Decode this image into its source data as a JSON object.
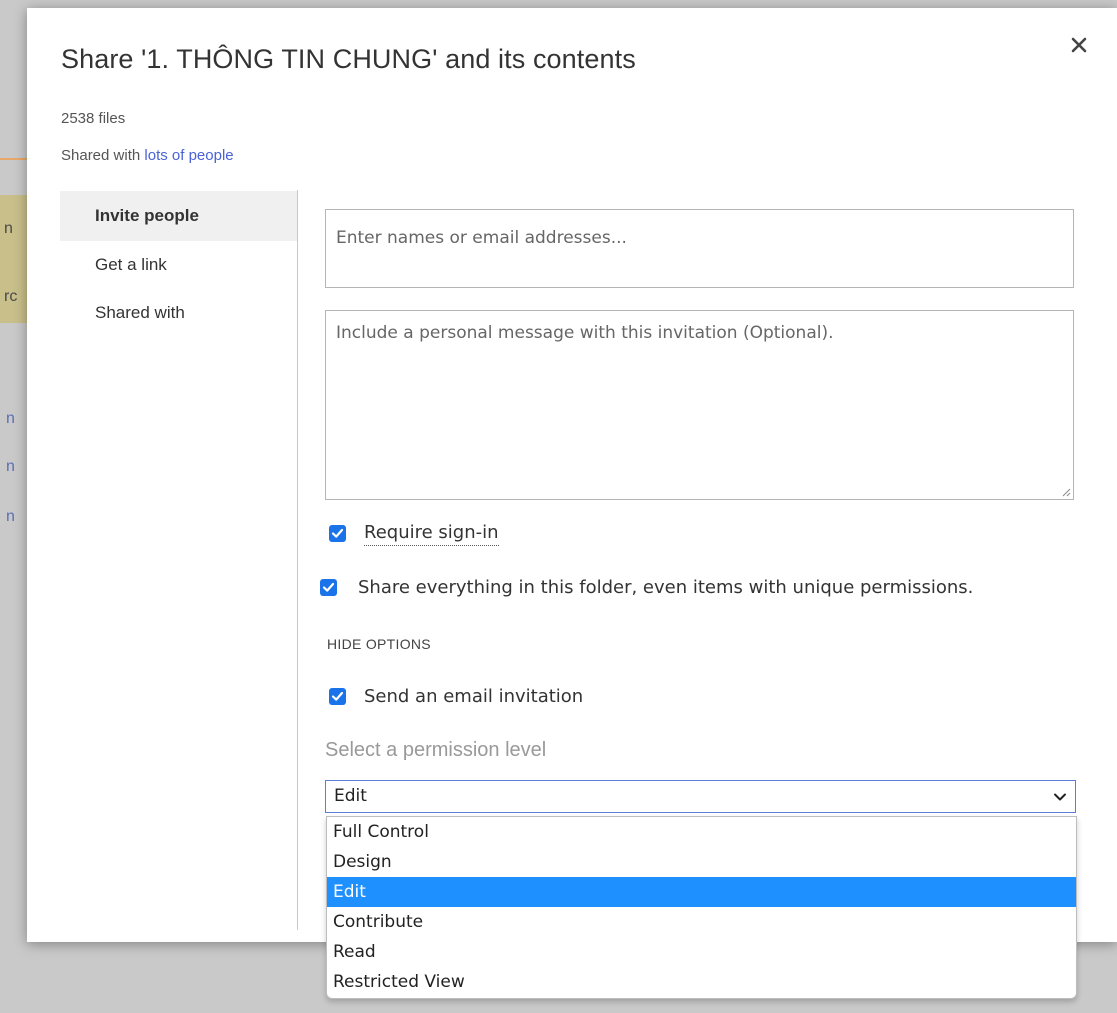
{
  "background": {
    "fragments": [
      "n",
      "rc"
    ],
    "links": [
      "n",
      "n",
      "n"
    ]
  },
  "dialog": {
    "title": "Share '1. THÔNG TIN CHUNG' and its contents",
    "file_count": "2538 files",
    "shared_prefix": "Shared with ",
    "shared_link": "lots of people"
  },
  "nav": {
    "items": [
      {
        "label": "Invite people"
      },
      {
        "label": "Get a link"
      },
      {
        "label": "Shared with"
      }
    ]
  },
  "form": {
    "names_placeholder": "Enter names or email addresses...",
    "message_placeholder": "Include a personal message with this invitation (Optional).",
    "require_signin": {
      "label": "Require sign-in",
      "checked": true
    },
    "share_everything": {
      "label": "Share everything in this folder, even items with unique permissions.",
      "checked": true
    },
    "hide_options": "HIDE OPTIONS",
    "send_email": {
      "label": "Send an email invitation",
      "checked": true
    },
    "permission_heading": "Select a permission level",
    "permission_selected": "Edit",
    "permission_options": [
      "Full Control",
      "Design",
      "Edit",
      "Contribute",
      "Read",
      "Restricted View"
    ]
  },
  "colors": {
    "accent": "#1a73e8",
    "selected_option": "#1e90ff",
    "link": "#4a63d6"
  }
}
